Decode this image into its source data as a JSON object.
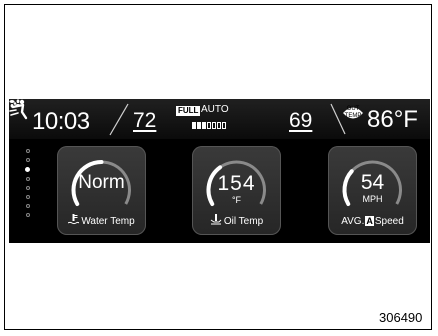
{
  "status_bar": {
    "clock": "10:03",
    "driver_temp": "72",
    "full_badge": "FULL",
    "auto_label": "AUTO",
    "fan_level": 3,
    "fan_levels_total": 7,
    "passenger_temp": "69",
    "outside_label_top": "OUT",
    "outside_label_bottom": "TEMP",
    "outside_temp": "86°F"
  },
  "page_indicator": {
    "count": 8,
    "active_index": 2
  },
  "gauges": [
    {
      "value": "Norm",
      "unit": "",
      "label": "Water Temp",
      "icon": "water-temp-icon",
      "level": 0.5
    },
    {
      "value": "154",
      "unit": "°F",
      "label": "Oil Temp",
      "icon": "oil-temp-icon",
      "level": 0.35
    },
    {
      "value": "54",
      "unit": "MPH",
      "label_prefix": "AVG.",
      "badge": "A",
      "label": "Speed",
      "icon": "avg-speed",
      "level": 0.3
    }
  ],
  "figure_number": "306490"
}
